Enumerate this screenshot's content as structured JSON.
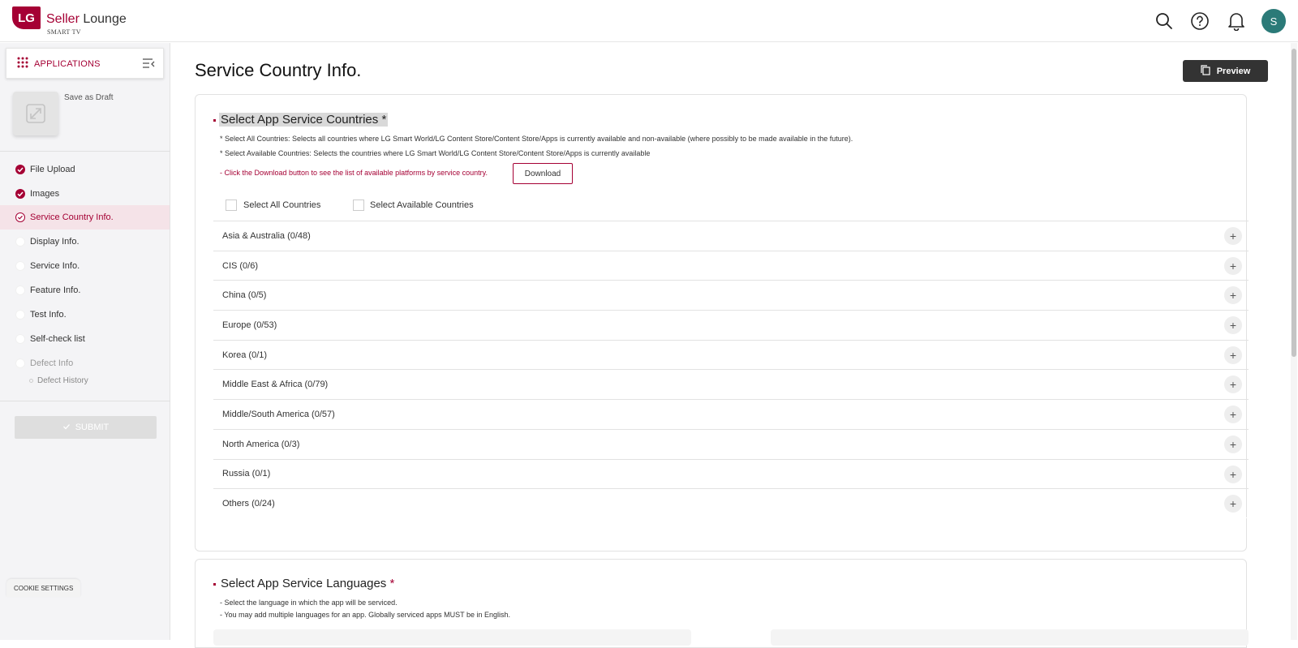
{
  "header": {
    "logo_text": "LG",
    "brand_primary": "Seller",
    "brand_secondary": "Lounge",
    "brand_sub": "SMART TV",
    "avatar_initial": "S",
    "accent_color": "#a50034"
  },
  "sidebar": {
    "apps_label": "APPLICATIONS",
    "save_draft": "Save as Draft",
    "items": [
      {
        "label": "File Upload",
        "state": "done"
      },
      {
        "label": "Images",
        "state": "done"
      },
      {
        "label": "Service Country Info.",
        "state": "current"
      },
      {
        "label": "Display Info.",
        "state": "empty"
      },
      {
        "label": "Service Info.",
        "state": "empty"
      },
      {
        "label": "Feature Info.",
        "state": "empty"
      },
      {
        "label": "Test Info.",
        "state": "empty"
      },
      {
        "label": "Self-check list",
        "state": "empty"
      },
      {
        "label": "Defect Info",
        "state": "disabled"
      }
    ],
    "sub_item": "Defect History",
    "submit_label": "SUBMIT"
  },
  "cookie_settings": "COOKIE SETTINGS",
  "main": {
    "page_title": "Service Country Info.",
    "preview_label": "Preview",
    "countries": {
      "title": "Select App Service Countries",
      "required_mark": "*",
      "note_all": "* Select All Countries: Selects all countries where LG Smart World/LG Content Store/Content Store/Apps is currently available and non-available (where possibly to be made available in the future).",
      "note_available": "* Select Available Countries: Selects the countries where LG Smart World/LG Content Store/Content Store/Apps is currently available",
      "download_note": "- Click the Download button to see the list of available platforms by service country.",
      "download_label": "Download",
      "select_all_label": "Select All Countries",
      "select_available_label": "Select Available Countries",
      "regions": [
        "Asia & Australia (0/48)",
        "CIS (0/6)",
        "China (0/5)",
        "Europe (0/53)",
        "Korea (0/1)",
        "Middle East & Africa (0/79)",
        "Middle/South America (0/57)",
        "North America (0/3)",
        "Russia (0/1)",
        "Others (0/24)"
      ]
    },
    "languages": {
      "title": "Select App Service Languages",
      "required_mark": "*",
      "note_1": "- Select the language in which the app will be serviced.",
      "note_2": "- You may add multiple languages for an app. Globally serviced apps MUST be in English."
    }
  }
}
